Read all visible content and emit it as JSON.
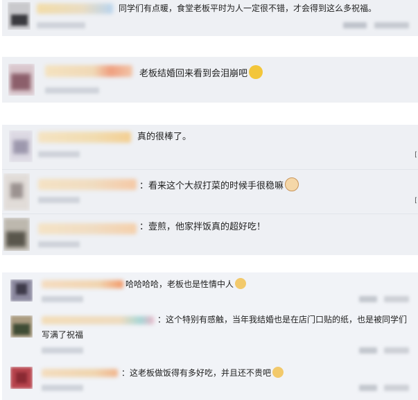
{
  "section1": {
    "comment": "同学们有点暖，食堂老板平时为人一定很不错，才会得到这么多祝福。"
  },
  "section2": {
    "comment": "老板结婚回来看到会泪崩吧",
    "emoji_icon": "crying-face-icon"
  },
  "section3": {
    "main_comment": "真的很棒了。",
    "replies": [
      {
        "text": "：看来这个大叔打菜的时候手很稳嘛",
        "emoji_icon": "cat-face-icon"
      },
      {
        "text": "：壹煎，他家拌饭真的超好吃！"
      }
    ],
    "edge_glyph": "["
  },
  "section4": {
    "replies": [
      {
        "text": "哈哈哈哈，老板也是性情中人",
        "emoji_icon": "dog-face-icon"
      },
      {
        "text": "：这个特别有感触，当年我结婚也是在店门口贴的纸，也是被同学们",
        "text_line2": "写满了祝福"
      },
      {
        "text": "：这老板做饭得有多好吃，并且还不贵吧",
        "emoji_icon": "dog-face-icon"
      }
    ]
  },
  "colors": {
    "panel_background": "#eef0f4",
    "page_background": "#ffffff",
    "text": "#222222"
  }
}
